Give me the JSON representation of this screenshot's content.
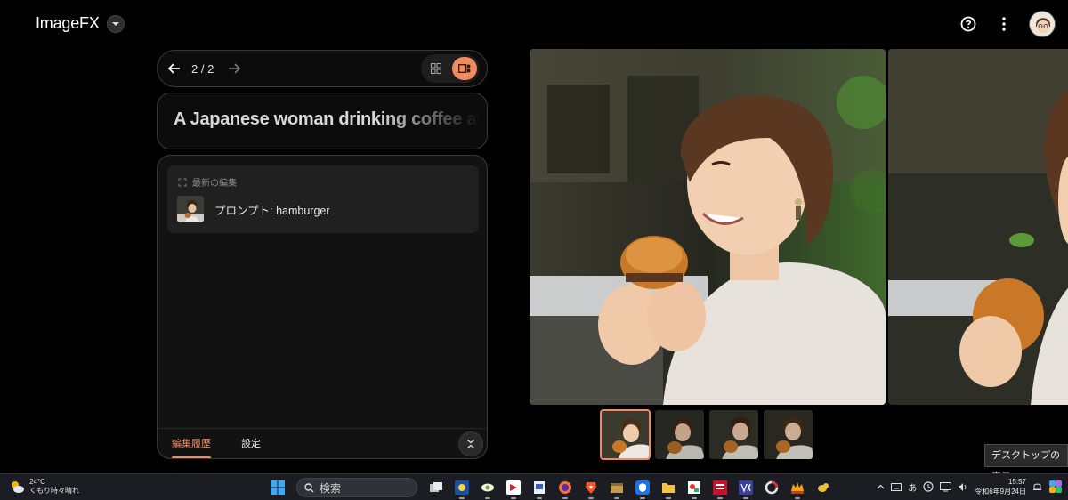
{
  "app": {
    "name": "ImageFX"
  },
  "pager": {
    "count": "2 / 2"
  },
  "prompt": {
    "text": "A Japanese woman drinking coffee at"
  },
  "history": {
    "header": "最新の編集",
    "items": [
      {
        "prompt": "プロンプト: hamburger"
      }
    ]
  },
  "panel_tabs": {
    "history": "編集履歴",
    "settings": "設定"
  },
  "tooltip": "デスクトップの表示",
  "taskbar": {
    "weather_temp": "24°C",
    "weather_desc": "くもり時々晴れ",
    "search_placeholder": "検索",
    "ime": "あ",
    "time": "15:57",
    "date": "令和6年9月24日"
  },
  "colors": {
    "accent": "#f08a60",
    "background": "#000000",
    "panel": "#121212"
  }
}
